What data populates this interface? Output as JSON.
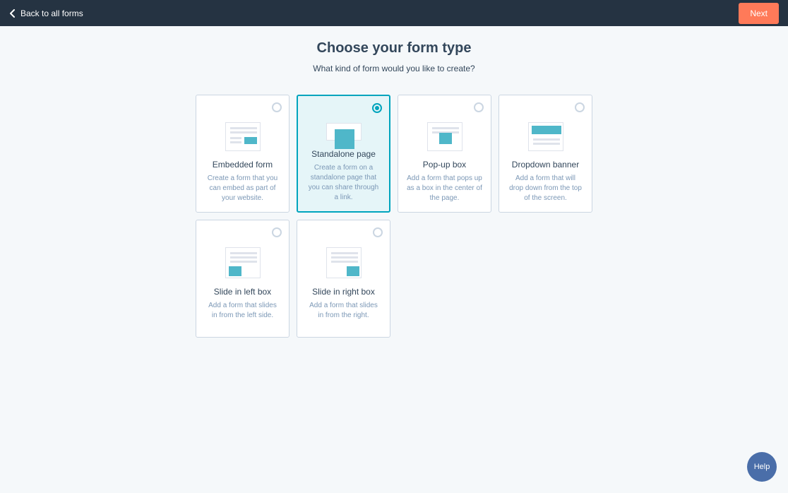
{
  "header": {
    "back_label": "Back to all forms",
    "next_label": "Next"
  },
  "page": {
    "title": "Choose your form type",
    "subtitle": "What kind of form would you like to create?"
  },
  "cards": [
    {
      "title": "Embedded form",
      "desc": "Create a form that you can embed as part of your website.",
      "selected": false,
      "thumb": "embedded"
    },
    {
      "title": "Standalone page",
      "desc": "Create a form on a standalone page that you can share through a link.",
      "selected": true,
      "thumb": "standalone"
    },
    {
      "title": "Pop-up box",
      "desc": "Add a form that pops up as a box in the center of the page.",
      "selected": false,
      "thumb": "popup"
    },
    {
      "title": "Dropdown banner",
      "desc": "Add a form that will drop down from the top of the screen.",
      "selected": false,
      "thumb": "dropdown"
    },
    {
      "title": "Slide in left box",
      "desc": "Add a form that slides in from the left side.",
      "selected": false,
      "thumb": "slide-left"
    },
    {
      "title": "Slide in right box",
      "desc": "Add a form that slides in from the right.",
      "selected": false,
      "thumb": "slide-right"
    }
  ],
  "help": {
    "label": "Help"
  }
}
